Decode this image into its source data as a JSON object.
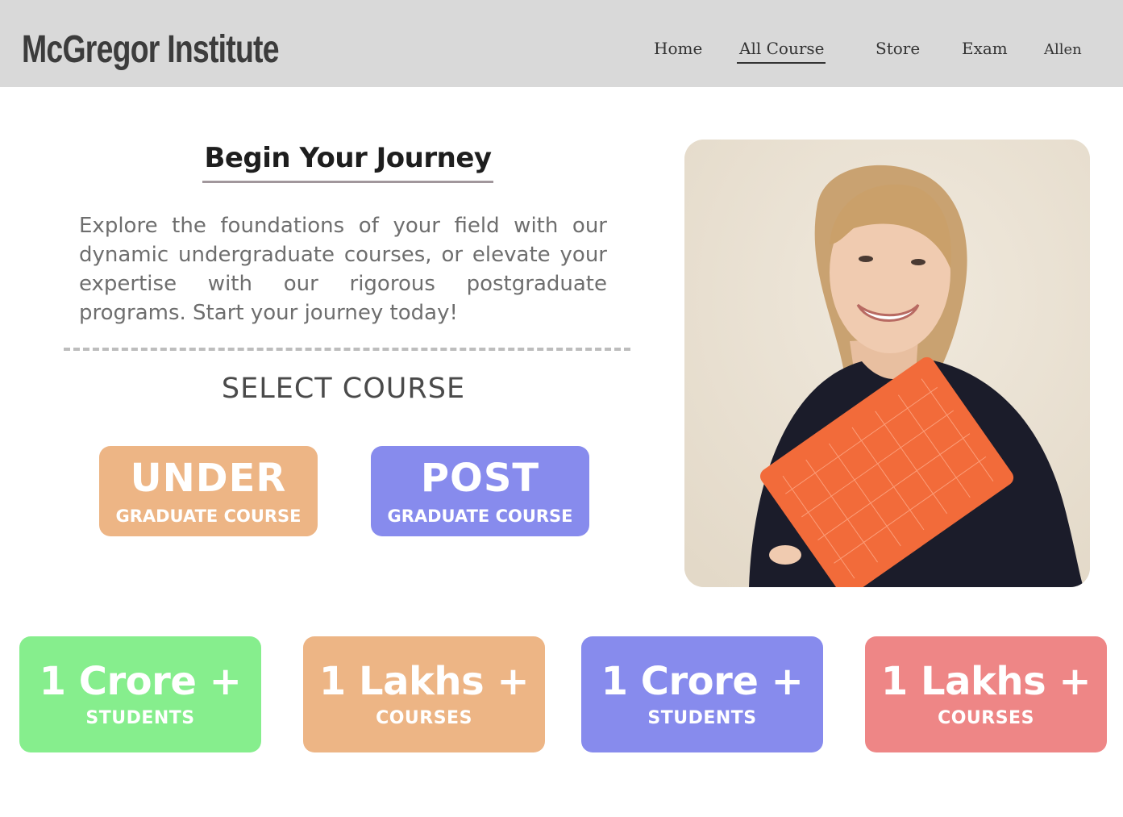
{
  "header": {
    "brand": "McGregor Institute",
    "nav": [
      {
        "label": "Home"
      },
      {
        "label": "All Course",
        "active": true
      },
      {
        "label": "Store"
      },
      {
        "label": "Exam"
      },
      {
        "label": "Allen"
      }
    ]
  },
  "hero": {
    "title": "Begin Your Journey",
    "description": "Explore the foundations of your field with our dynamic undergraduate courses, or elevate your expertise with our rigorous postgraduate programs. Start your journey today!",
    "select_label": "SELECT COURSE",
    "courses": [
      {
        "big": "UNDER",
        "small": "GRADUATE COURSE",
        "color": "#edb585"
      },
      {
        "big": "POST",
        "small": "GRADUATE COURSE",
        "color": "#878bed"
      }
    ]
  },
  "photo": {
    "icon": "student-holding-book-photo"
  },
  "stats": [
    {
      "value": "1 Crore +",
      "label": "STUDENTS",
      "color": "#86ee8d"
    },
    {
      "value": "1 Lakhs +",
      "label": "COURSES",
      "color": "#edb585"
    },
    {
      "value": "1 Crore +",
      "label": "STUDENTS",
      "color": "#878bed"
    },
    {
      "value": "1 Lakhs +",
      "label": "COURSES",
      "color": "#ee8686"
    }
  ]
}
